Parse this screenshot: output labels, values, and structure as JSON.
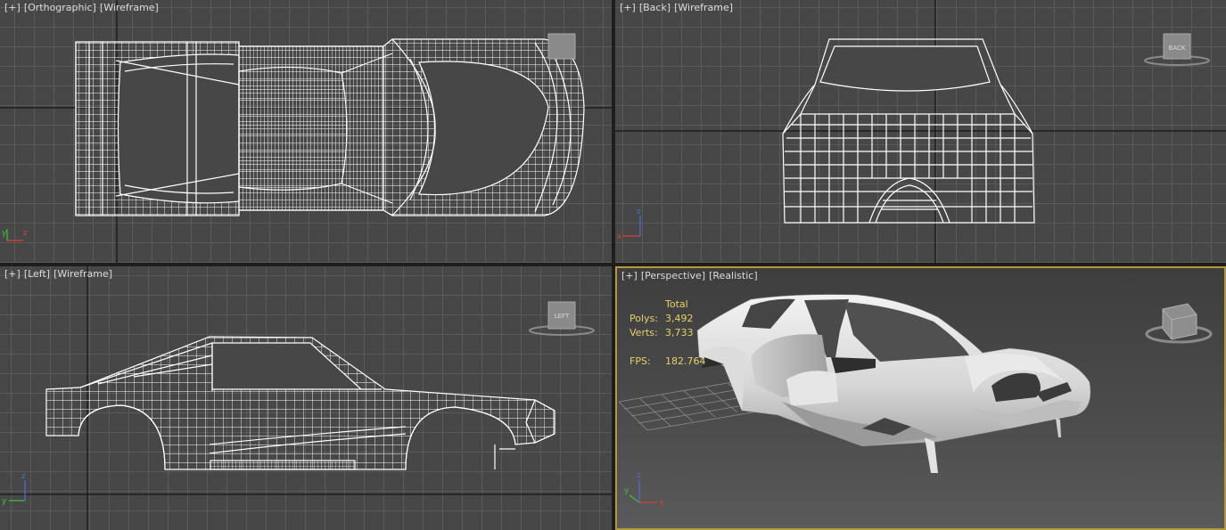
{
  "viewports": {
    "top": {
      "plus": "[+]",
      "view": "[Orthographic]",
      "shading": "[Wireframe]"
    },
    "back": {
      "plus": "[+]",
      "view": "[Back]",
      "shading": "[Wireframe]",
      "viewcube": "BACK"
    },
    "left": {
      "plus": "[+]",
      "view": "[Left]",
      "shading": "[Wireframe]",
      "viewcube": "LEFT"
    },
    "perspective": {
      "plus": "[+]",
      "view": "[Perspective]",
      "shading": "[Realistic]"
    }
  },
  "stats": {
    "header": "Total",
    "polys_label": "Polys:",
    "polys_value": "3,492",
    "verts_label": "Verts:",
    "verts_value": "3,733",
    "fps_label": "FPS:",
    "fps_value": "182.764"
  },
  "axis": {
    "x": "x",
    "y": "y",
    "z": "z"
  },
  "colors": {
    "active_border": "#b5973e",
    "stats_text": "#e6d06b",
    "grid": "#5a5a5a",
    "viewport_bg": "#474747"
  }
}
